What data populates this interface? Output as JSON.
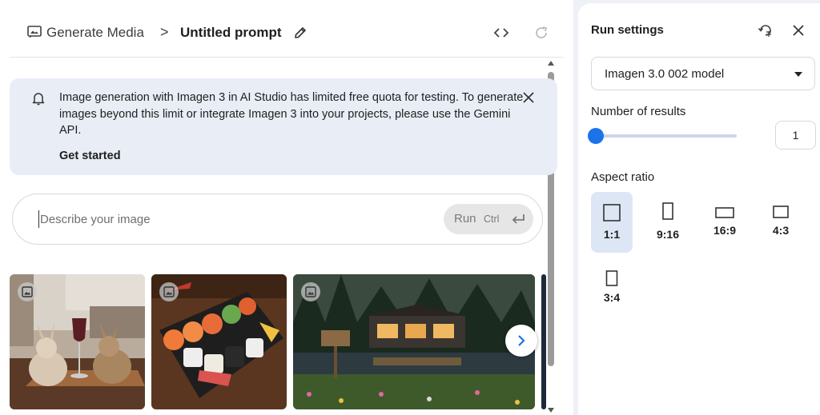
{
  "header": {
    "breadcrumb_root": "Generate Media",
    "breadcrumb_separator": ">",
    "title": "Untitled prompt"
  },
  "banner": {
    "text": "Image generation with Imagen 3 in AI Studio has limited free quota for testing. To generate images beyond this limit or integrate Imagen 3 into your projects, please use the Gemini API.",
    "link": "Get started"
  },
  "prompt": {
    "placeholder": "Describe your image",
    "value": "",
    "run_label": "Run",
    "run_shortcut": "Ctrl"
  },
  "gallery": {
    "items": [
      {
        "subject": "two rabbits beside a wine glass in a kitchen"
      },
      {
        "subject": "sushi platter on a dark tray"
      },
      {
        "subject": "lakeside cabin in a forest at dusk"
      }
    ]
  },
  "run_settings": {
    "title": "Run settings",
    "model": "Imagen 3.0 002 model",
    "number_label": "Number of results",
    "number_value": "1",
    "slider_fraction": 0,
    "aspect_label": "Aspect ratio",
    "aspect_options": [
      {
        "label": "1:1",
        "selected": true
      },
      {
        "label": "9:16",
        "selected": false
      },
      {
        "label": "16:9",
        "selected": false
      },
      {
        "label": "4:3",
        "selected": false
      },
      {
        "label": "3:4",
        "selected": false
      }
    ]
  },
  "colors": {
    "accent": "#1a73e8",
    "banner_bg": "#e8edf6",
    "selected_bg": "#dde6f5"
  },
  "icons": [
    "media-icon",
    "edit-icon",
    "code-icon",
    "refresh-icon",
    "bell-icon",
    "close-icon",
    "enter-icon",
    "image-badge-icon",
    "chevron-right-icon",
    "reset-settings-icon",
    "caret-down-icon"
  ]
}
